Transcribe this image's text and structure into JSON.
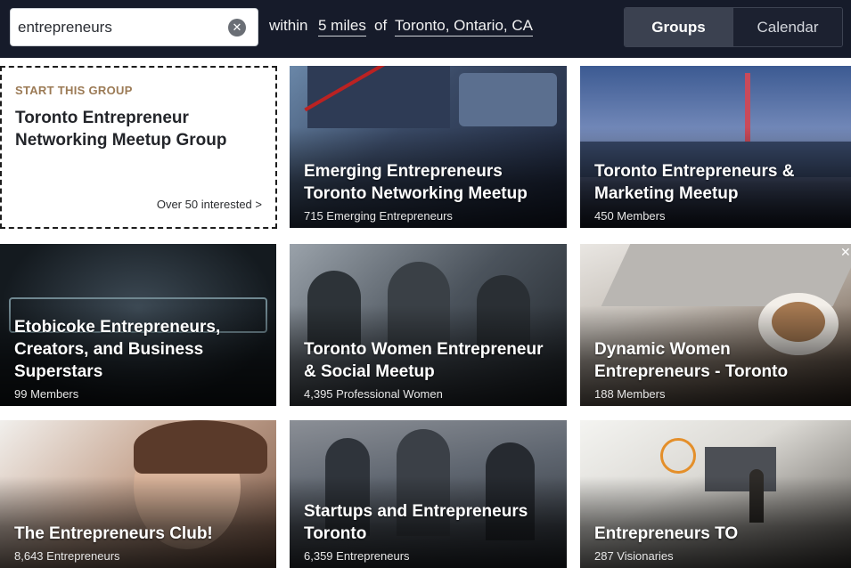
{
  "search": {
    "value": "entrepreneurs",
    "clear_icon": "close-icon"
  },
  "filters": {
    "within": "within",
    "distance": "5 miles",
    "of": "of",
    "location": "Toronto, Ontario, CA"
  },
  "view_toggle": {
    "groups": "Groups",
    "calendar": "Calendar",
    "active": "Groups"
  },
  "start_group": {
    "label": "START THIS GROUP",
    "title": "Toronto Entrepreneur Networking Meetup Group",
    "interest": "Over 50 interested >"
  },
  "groups": [
    {
      "title": "Emerging Entrepreneurs Toronto Networking Meetup",
      "members": "715 Emerging Entrepreneurs"
    },
    {
      "title": "Toronto Entrepreneurs & Marketing Meetup",
      "members": "450 Members"
    },
    {
      "title": "Etobicoke Entrepreneurs, Creators, and Business Superstars",
      "members": "99 Members"
    },
    {
      "title": "Toronto Women Entrepreneur & Social Meetup",
      "members": "4,395 Professional Women"
    },
    {
      "title": "Dynamic Women Entrepreneurs - Toronto",
      "members": "188 Members"
    },
    {
      "title": "The Entrepreneurs Club!",
      "members": "8,643 Entrepreneurs"
    },
    {
      "title": "Startups and Entrepreneurs Toronto",
      "members": "6,359 Entrepreneurs"
    },
    {
      "title": "Entrepreneurs TO",
      "members": "287 Visionaries"
    }
  ],
  "dismiss_icon": "close-icon"
}
